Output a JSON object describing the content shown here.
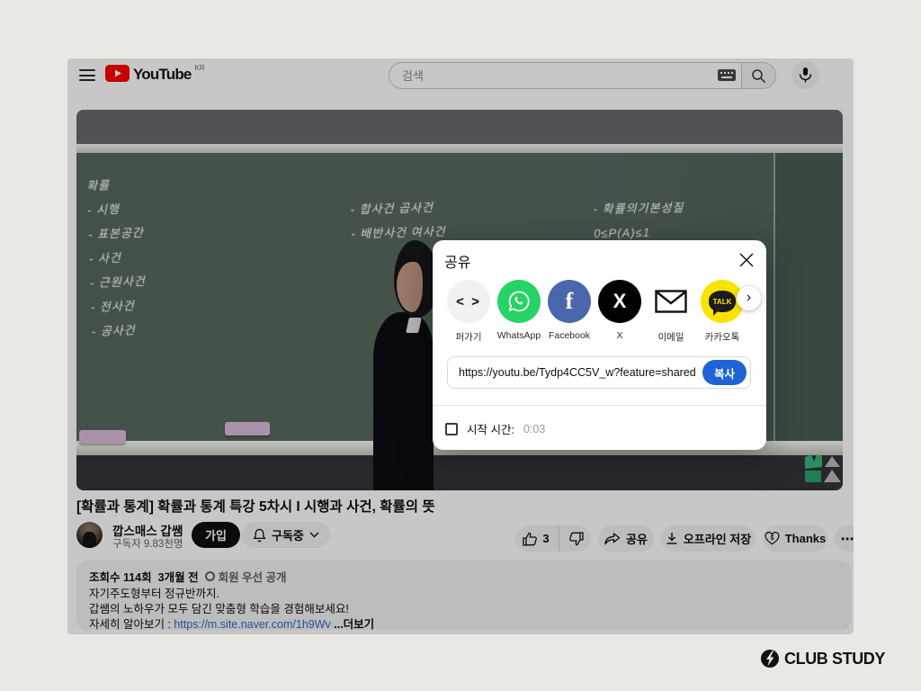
{
  "colors": {
    "accent_blue": "#1f63d4",
    "youtube_red": "#ff0000",
    "whatsapp_green": "#25d366",
    "facebook_blue": "#4a67ad",
    "kakao_yellow": "#fbe300",
    "scrim": "rgba(0,0,0,0.22)"
  },
  "header": {
    "brand": "YouTube",
    "region": "KR",
    "search_placeholder": "검색"
  },
  "video_player": {
    "board_left": [
      "확률",
      "- 시행",
      "- 표본공간",
      "- 사건",
      "- 근원사건",
      "- 전사건",
      "- 공사건"
    ],
    "board_mid": [
      "- 합사건 곱사건",
      "- 배반사건 여사건"
    ],
    "board_right": [
      "- 확률의기본성질",
      "0≤P(A)≤1"
    ]
  },
  "share_dialog": {
    "title": "공유",
    "targets": [
      {
        "label": "퍼가기"
      },
      {
        "label": "WhatsApp"
      },
      {
        "label": "Facebook"
      },
      {
        "label": "X"
      },
      {
        "label": "이메일"
      },
      {
        "label": "카카오톡"
      }
    ],
    "embed_glyph": "< >",
    "fb_glyph": "f",
    "x_glyph": "X",
    "kakao_glyph": "TALK",
    "next_glyph": "›",
    "url": "https://youtu.be/Tydp4CC5V_w?feature=shared",
    "copy_label": "복사",
    "start_time_label": "시작 시간:",
    "start_time_value": "0:03"
  },
  "video_info": {
    "title": "[확률과 통계] 확률과 통계 특강 5차시 I 시행과 사건, 확률의 뜻",
    "channel_name": "깝스매스 갑쌤",
    "subscribers": "구독자 9.83천명",
    "join_label": "가입",
    "subscribed_label": "구독중",
    "like_count": "3",
    "share_label": "공유",
    "download_label": "오프라인 저장",
    "thanks_label": "Thanks",
    "more_glyph": "⋯"
  },
  "description": {
    "views": "조회수 114회",
    "age": "3개월 전",
    "badge": "회원 우선 공개",
    "line2": "자기주도형부터 정규반까지.",
    "line3": "갑쌤의 노하우가 모두 담긴 맞춤형 학습을 경험해보세요!",
    "line4_prefix": "자세히 알아보기 : ",
    "link": "https://m.site.naver.com/1h9Wv",
    "more_label": " ...더보기"
  },
  "footer": {
    "brand": "CLUB STUDY"
  }
}
